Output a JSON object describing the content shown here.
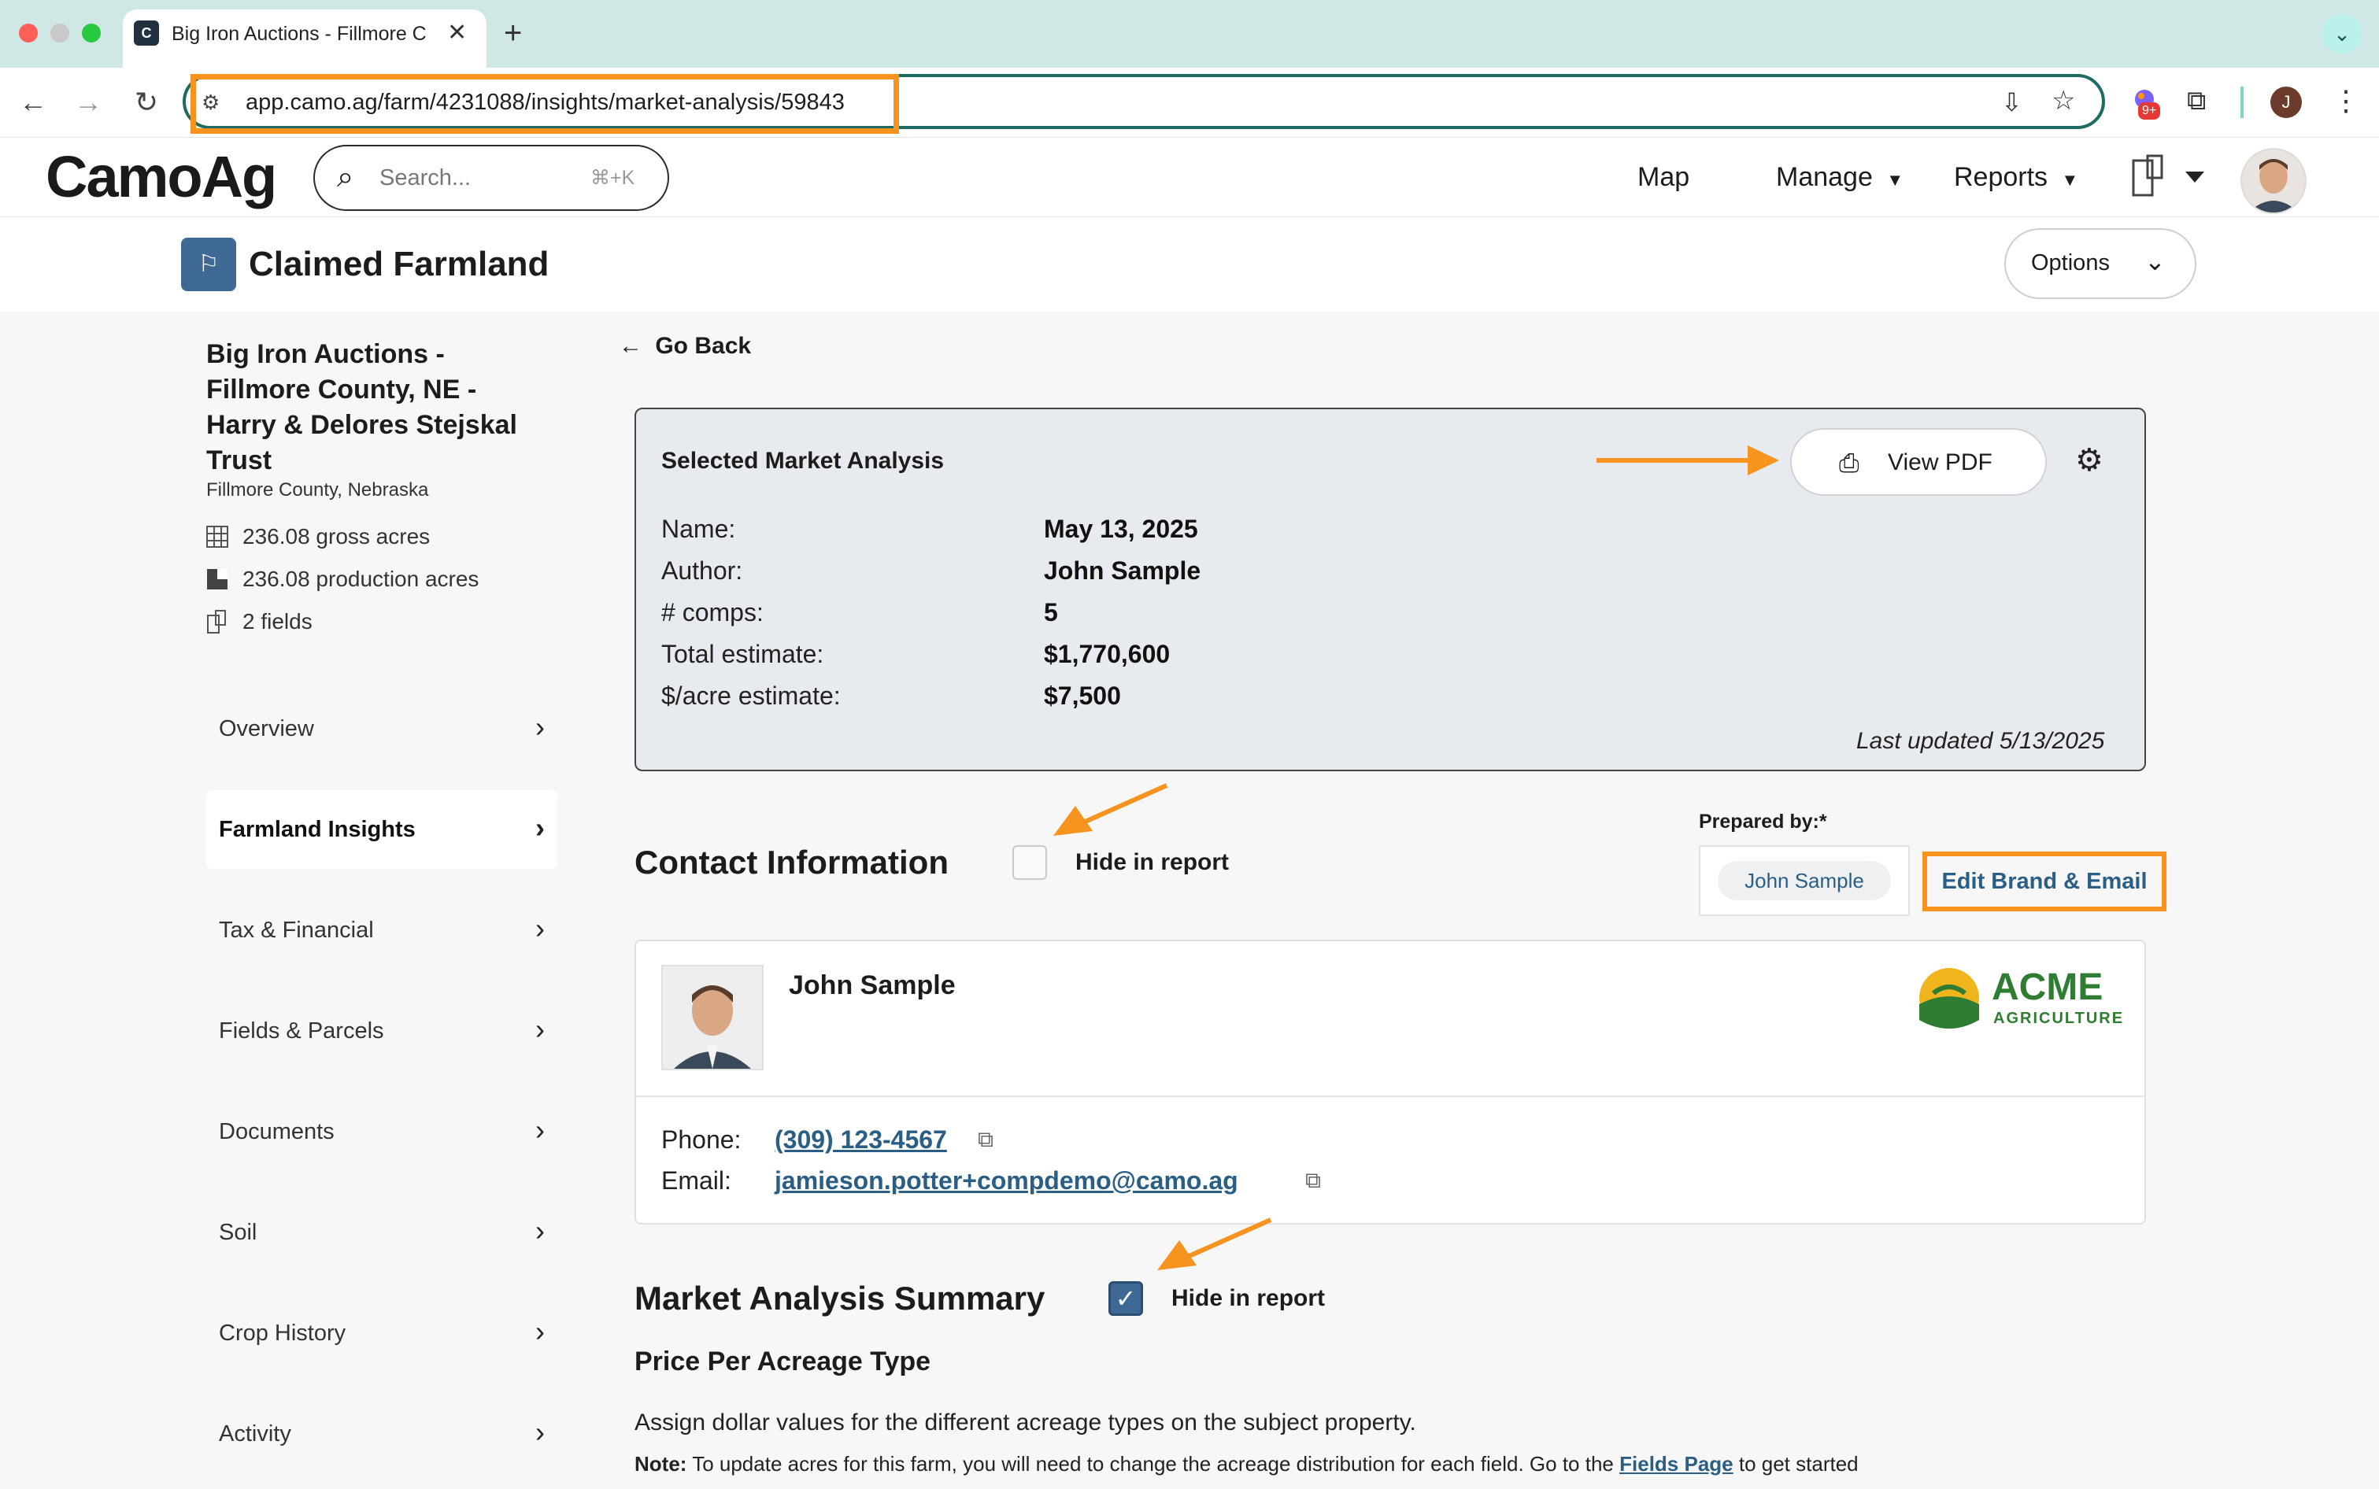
{
  "browser": {
    "tab_title": "Big Iron Auctions - Fillmore C",
    "url": "app.camo.ag/farm/4231088/insights/market-analysis/59843",
    "extension_badge": "9+",
    "profile_initial": "J"
  },
  "app": {
    "logo_text": "CamoAg",
    "search_placeholder": "Search...",
    "search_shortcut": "⌘+K",
    "nav": {
      "map": "Map",
      "manage": "Manage",
      "reports": "Reports"
    }
  },
  "page": {
    "title": "Claimed Farmland",
    "options_label": "Options"
  },
  "sidebar": {
    "farm_name": "Big Iron Auctions - Fillmore County, NE - Harry & Delores Stejskal Trust",
    "location": "Fillmore County, Nebraska",
    "gross_acres": "236.08 gross acres",
    "production_acres": "236.08 production acres",
    "fields": "2 fields",
    "items": [
      {
        "label": "Overview"
      },
      {
        "label": "Farmland Insights"
      },
      {
        "label": "Tax & Financial"
      },
      {
        "label": "Fields & Parcels"
      },
      {
        "label": "Documents"
      },
      {
        "label": "Soil"
      },
      {
        "label": "Crop History"
      },
      {
        "label": "Activity"
      }
    ]
  },
  "main": {
    "go_back": "Go Back",
    "analysis": {
      "title": "Selected Market Analysis",
      "view_pdf": "View PDF",
      "rows": [
        {
          "key": "Name:",
          "value": "May 13, 2025"
        },
        {
          "key": "Author:",
          "value": "John Sample"
        },
        {
          "key": "# comps:",
          "value": "5"
        },
        {
          "key": "Total estimate:",
          "value": "$1,770,600"
        },
        {
          "key": "$/acre estimate:",
          "value": "$7,500"
        }
      ],
      "last_updated": "Last updated 5/13/2025"
    },
    "contact": {
      "section_title": "Contact Information",
      "hide_label": "Hide in report",
      "hide_checked": false,
      "prepared_by_label": "Prepared by:*",
      "prepared_by_value": "John Sample",
      "edit_brand": "Edit Brand & Email",
      "name": "John Sample",
      "phone_label": "Phone:",
      "phone": "(309) 123-4567",
      "email_label": "Email:",
      "email": "jamieson.potter+compdemo@camo.ag",
      "brand_name": "ACME",
      "brand_sub": "AGRICULTURE"
    },
    "summary": {
      "section_title": "Market Analysis Summary",
      "hide_label": "Hide in report",
      "hide_checked": true,
      "sub_title": "Price Per Acreage Type",
      "description": "Assign dollar values for the different acreage types on the subject property.",
      "note_label": "Note:",
      "note_text": "To update acres for this farm, you will need to change the acreage distribution for each field. Go to the",
      "note_link": "Fields Page",
      "note_tail": "to get started"
    }
  },
  "colors": {
    "accent": "#3d6994",
    "link": "#2b5e85",
    "highlight": "#f7931e",
    "brand_green": "#2e7d32",
    "chrome_tab_bar": "#cfe8e5"
  }
}
